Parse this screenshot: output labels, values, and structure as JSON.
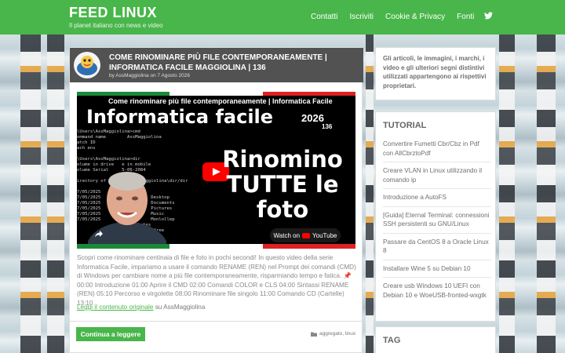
{
  "header": {
    "site_title": "FEED LINUX",
    "tagline": "Il planet italiano con news e video",
    "nav": [
      "Contatti",
      "Iscriviti",
      "Cookie & Privacy",
      "Fonti"
    ]
  },
  "article": {
    "title": "COME RINOMINARE PIÙ FILE CONTEMPORANEAMENTE | INFORMATICA FACILE MAGGIOLINA | 136",
    "meta": "by AssMaggiolina on 7 Agosto 2026",
    "video": {
      "title": "Come rinominare più file contemporaneamente | Informatica Facile",
      "banner": "Informatica facile",
      "year": "2026",
      "episode": "136",
      "big_text": "Rinomino TUTTE le foto",
      "watch_label": "Watch on",
      "yt_label": "YouTube",
      "terminal": "\\Users\\AssMaggiolina>cmd\nommand name        AssMaggiolina\natch ID\nach ens\n\n\\Users\\AssMaggiolina>dir\nolume in drive   e in mobile\nolume Serial     5-06-2084\n\nirectory of C:\\Users\\AssMaggiolina\\dir/dir\n\n7/05/2025     <DIR>\n7/05/2025     <DIR>         Desktop\n7/05/2025     <DIR>         Documents\n7/05/2025     <DIR>         Pictures\n7/05/2025     <DIR>         Music\n7/05/2025     <DIR>         Monlollep\n                13,250 bytes\n               228,316 bytes free"
    },
    "excerpt": "Scopri come rinominare centinaia di file e foto in pochi secondi! In questo video della serie Informatica Facile, impariamo a usare il comando RENAME (REN) nel Prompt dei comandi (CMD) di Windows per cambiare nome a più file contemporaneamente, risparmiando tempo e fatica. 📌 00:00 Introduzione 01:00 Aprire il CMD 02:00 Comandi COLOR e CLS 04:00 Sintassi RENAME (REN) 05:10 Percorso e virgolette 08:00 Rinominare file singolo 11:00 Comando CD (Cartelle) 13:10",
    "read_link": "Leggi il contenuto originale",
    "read_suffix": " su AssMaggiolina",
    "continue_label": "Continua a leggere",
    "tags": "aggregato, linux"
  },
  "sidebar": {
    "notice": "Gli articoli, le immagini, i marchi, i video e gli ulteriori segni distintivi utilizzati appartengono ai rispettivi proprietari.",
    "tutorial_heading": "TUTORIAL",
    "tutorials": [
      "Convertire Fumetti Cbr/Cbz in Pdf con AllCbrztoPdf",
      "Creare VLAN in Linux utilizzando il comando ip",
      "Introduzione a AutoFS",
      "[Guida] Eternal Terminal: connessioni SSH persistenti su GNU/Linux",
      "Passare da CentOS 8 a Oracle Linux 8",
      "Installare Wine 5 su Debian 10",
      "Creare usb Windows 10 UEFI con Debian 10 e WoeUSB-fronted-wxgtk"
    ],
    "tag_heading": "TAG"
  },
  "colors": {
    "accent": "#48b64a",
    "header_dark": "#525252"
  }
}
